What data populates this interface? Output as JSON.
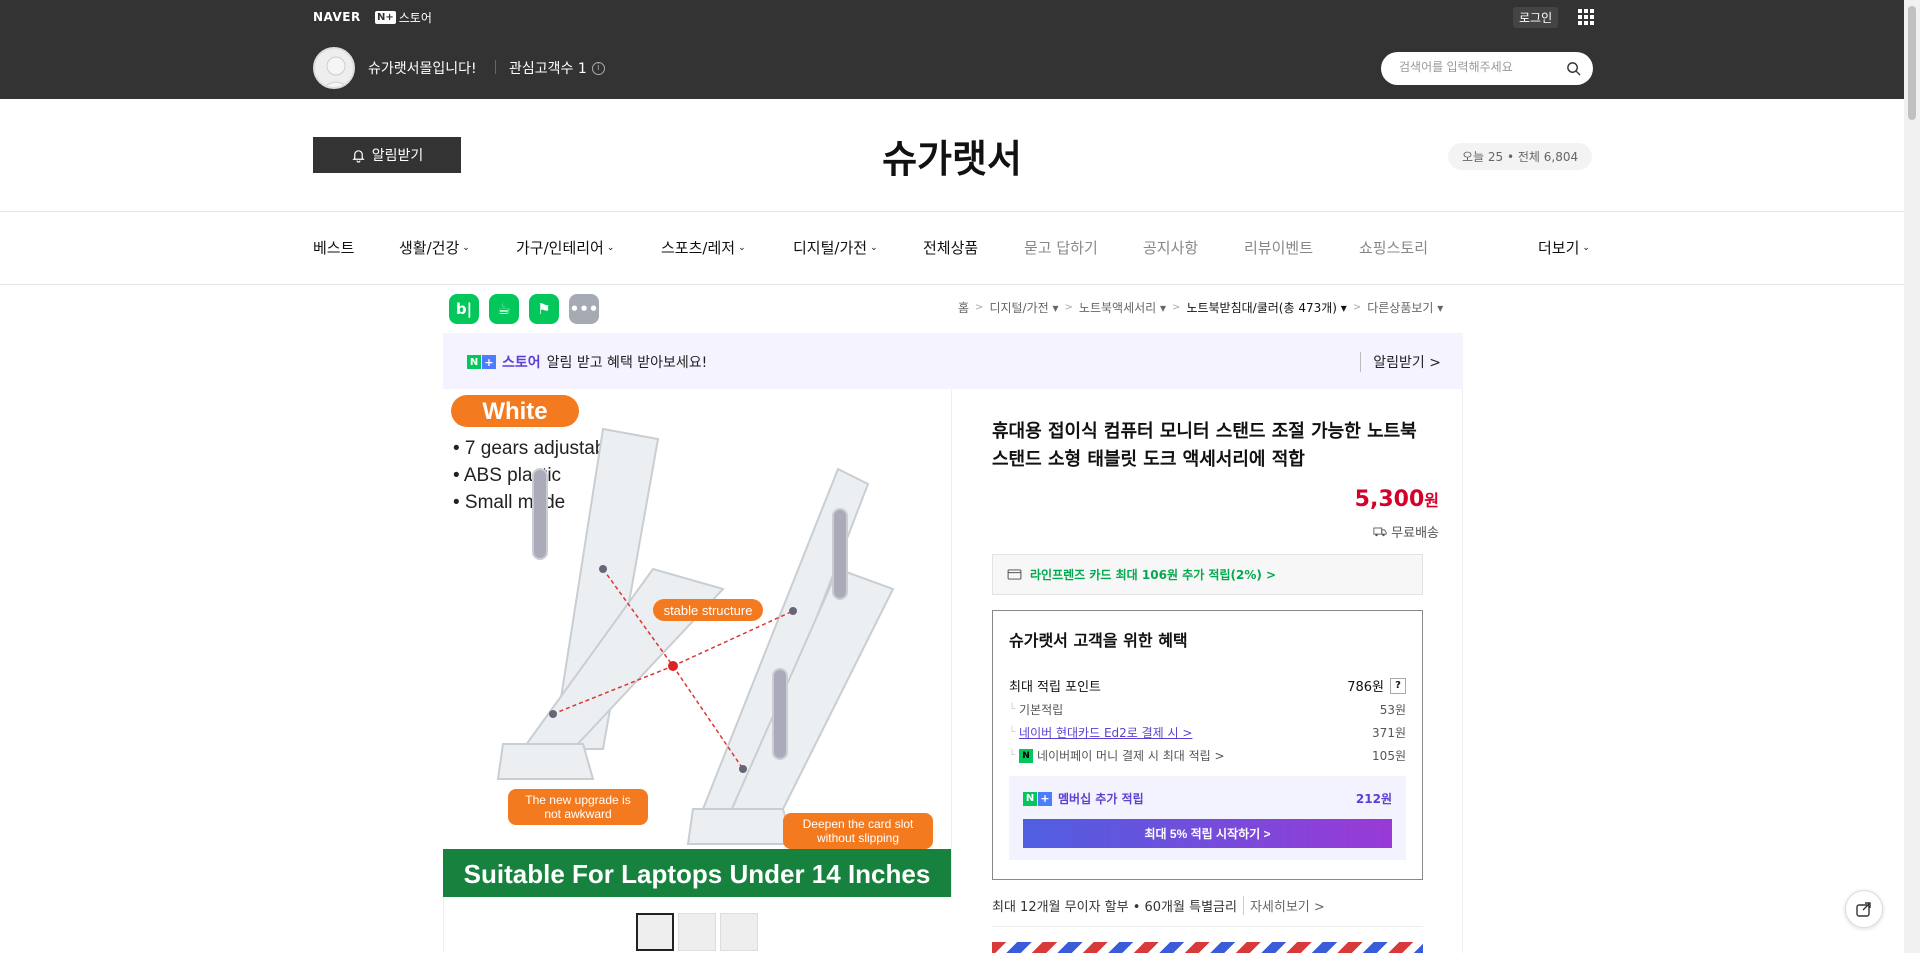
{
  "topbar": {
    "naver": "NAVER",
    "nstore_badge": "N+",
    "nstore_label": "스토어",
    "login": "로그인",
    "shop_greeting": "슈가랫서몰입니다!",
    "fans_label": "관심고객수 1",
    "search_placeholder": "검색어를 입력해주세요"
  },
  "header": {
    "alarm_button": "알림받기",
    "brand": "슈가랫서",
    "visitors": "오늘 25 • 전체 6,804"
  },
  "nav": {
    "items": [
      "베스트",
      "생활/건강",
      "가구/인테리어",
      "스포츠/레저",
      "디지털/가전",
      "전체상품",
      "묻고 답하기",
      "공지사항",
      "리뷰이벤트",
      "쇼핑스토리",
      "더보기"
    ]
  },
  "social_icons": [
    "blog-icon",
    "talk-icon",
    "bookmark-icon",
    "more-icon"
  ],
  "breadcrumb": {
    "home": "홈",
    "c1": "디지털/가전",
    "c2": "노트북액세서리",
    "c3": "노트북받침대/쿨러(총 473개)",
    "other": "다른상품보기"
  },
  "banner": {
    "store": "스토어",
    "text": "알림 받고 혜택 받아보세요!",
    "action": "알림받기 >"
  },
  "product": {
    "title": "휴대용 접이식 컴퓨터 모니터 스탠드 조절 가능한 노트북 스탠드 소형 태블릿 도크 액세서리에 적합",
    "price": "5,300",
    "price_unit": "원",
    "shipping": "무료배송",
    "card_offer": "라인프렌즈 카드 최대 106원 추가 적립(2%) >",
    "image": {
      "tag": "White",
      "bullets": [
        "• 7 gears adjustable",
        "• ABS plastic",
        "• Small mode"
      ],
      "callout1": "stable structure",
      "callout2": "The new upgrade is not awkward",
      "callout3": "Deepen the card slot without slipping",
      "footer": "Suitable For Laptops Under 14 Inches"
    }
  },
  "benefit": {
    "title": "슈가랫서 고객을 위한 혜택",
    "max_points_label": "최대 적립 포인트",
    "max_points": "786원",
    "rows": [
      {
        "label": "기본적립",
        "value": "53원"
      },
      {
        "label": "네이버 현대카드 Ed2로 결제 시 >",
        "value": "371원"
      },
      {
        "label": "네이버페이 머니 결제 시 최대 적립 >",
        "value": "105원"
      }
    ],
    "member_label": "멤버십 추가 적립",
    "member_value": "212원",
    "member_cta": "최대 5% 적립 시작하기 >"
  },
  "installment": {
    "text": "최대 12개월 무이자 할부 • 60개월 특별금리",
    "more": "자세히보기 >"
  },
  "colors": {
    "accent": "#5d3fd3",
    "price": "#d4002a",
    "naver_green": "#03c75a",
    "topbar": "#333333"
  }
}
